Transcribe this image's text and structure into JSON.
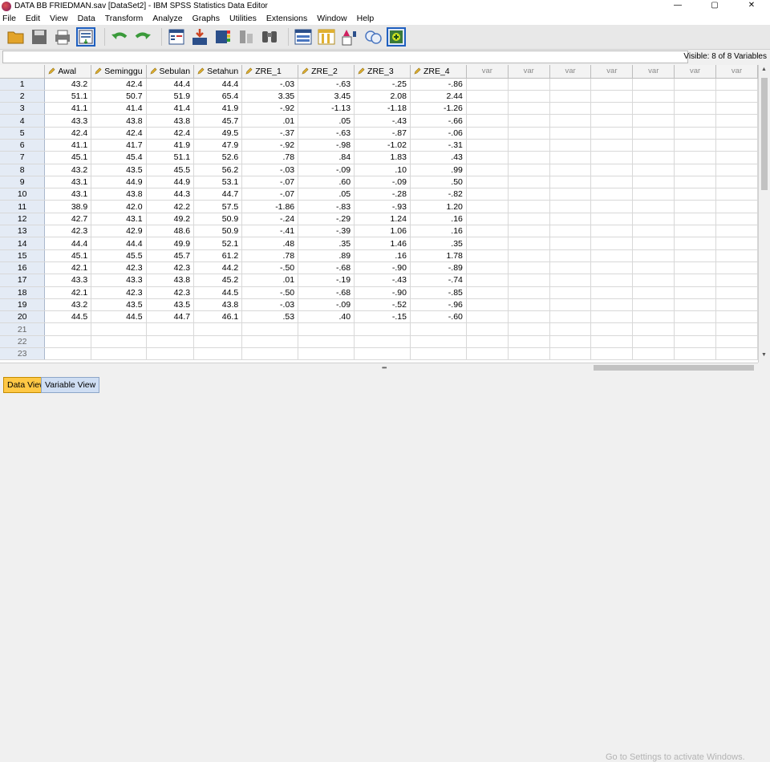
{
  "window": {
    "title": "DATA BB FRIEDMAN.sav [DataSet2] - IBM SPSS Statistics Data Editor",
    "minimize": "—",
    "maximize": "▢",
    "close": "✕"
  },
  "menu": [
    "File",
    "Edit",
    "View",
    "Data",
    "Transform",
    "Analyze",
    "Graphs",
    "Utilities",
    "Extensions",
    "Window",
    "Help"
  ],
  "toolbar": {
    "icons": [
      "open-folder-icon",
      "save-icon",
      "print-icon",
      "recall-dialog-icon",
      "undo-icon",
      "redo-icon",
      "goto-case-icon",
      "goto-variable-icon",
      "variables-icon",
      "run-descriptives-icon",
      "find-icon",
      "insert-cases-icon",
      "insert-variable-icon",
      "split-file-icon",
      "select-cases-icon",
      "value-labels-icon",
      "use-sets-icon"
    ]
  },
  "status": {
    "visible": "Visible: 8 of 8 Variables"
  },
  "grid": {
    "columns": [
      "Awal",
      "Seminggu",
      "Sebulan",
      "Setahun",
      "ZRE_1",
      "ZRE_2",
      "ZRE_3",
      "ZRE_4"
    ],
    "empty_columns": [
      "var",
      "var",
      "var",
      "var",
      "var",
      "var",
      "var"
    ],
    "rows": [
      [
        "1",
        "43.2",
        "42.4",
        "44.4",
        "44.4",
        "-.03",
        "-.63",
        "-.25",
        "-.86"
      ],
      [
        "2",
        "51.1",
        "50.7",
        "51.9",
        "65.4",
        "3.35",
        "3.45",
        "2.08",
        "2.44"
      ],
      [
        "3",
        "41.1",
        "41.4",
        "41.4",
        "41.9",
        "-.92",
        "-1.13",
        "-1.18",
        "-1.26"
      ],
      [
        "4",
        "43.3",
        "43.8",
        "43.8",
        "45.7",
        ".01",
        ".05",
        "-.43",
        "-.66"
      ],
      [
        "5",
        "42.4",
        "42.4",
        "42.4",
        "49.5",
        "-.37",
        "-.63",
        "-.87",
        "-.06"
      ],
      [
        "6",
        "41.1",
        "41.7",
        "41.9",
        "47.9",
        "-.92",
        "-.98",
        "-1.02",
        "-.31"
      ],
      [
        "7",
        "45.1",
        "45.4",
        "51.1",
        "52.6",
        ".78",
        ".84",
        "1.83",
        ".43"
      ],
      [
        "8",
        "43.2",
        "43.5",
        "45.5",
        "56.2",
        "-.03",
        "-.09",
        ".10",
        ".99"
      ],
      [
        "9",
        "43.1",
        "44.9",
        "44.9",
        "53.1",
        "-.07",
        ".60",
        "-.09",
        ".50"
      ],
      [
        "10",
        "43.1",
        "43.8",
        "44.3",
        "44.7",
        "-.07",
        ".05",
        "-.28",
        "-.82"
      ],
      [
        "11",
        "38.9",
        "42.0",
        "42.2",
        "57.5",
        "-1.86",
        "-.83",
        "-.93",
        "1.20"
      ],
      [
        "12",
        "42.7",
        "43.1",
        "49.2",
        "50.9",
        "-.24",
        "-.29",
        "1.24",
        ".16"
      ],
      [
        "13",
        "42.3",
        "42.9",
        "48.6",
        "50.9",
        "-.41",
        "-.39",
        "1.06",
        ".16"
      ],
      [
        "14",
        "44.4",
        "44.4",
        "49.9",
        "52.1",
        ".48",
        ".35",
        "1.46",
        ".35"
      ],
      [
        "15",
        "45.1",
        "45.5",
        "45.7",
        "61.2",
        ".78",
        ".89",
        ".16",
        "1.78"
      ],
      [
        "16",
        "42.1",
        "42.3",
        "42.3",
        "44.2",
        "-.50",
        "-.68",
        "-.90",
        "-.89"
      ],
      [
        "17",
        "43.3",
        "43.3",
        "43.8",
        "45.2",
        ".01",
        "-.19",
        "-.43",
        "-.74"
      ],
      [
        "18",
        "42.1",
        "42.3",
        "42.3",
        "44.5",
        "-.50",
        "-.68",
        "-.90",
        "-.85"
      ],
      [
        "19",
        "43.2",
        "43.5",
        "43.5",
        "43.8",
        "-.03",
        "-.09",
        "-.52",
        "-.96"
      ],
      [
        "20",
        "44.5",
        "44.5",
        "44.7",
        "46.1",
        ".53",
        ".40",
        "-.15",
        "-.60"
      ]
    ],
    "empty_rows": [
      "21",
      "22",
      "23"
    ]
  },
  "tabs": {
    "data_view": "Data View",
    "variable_view": "Variable View"
  },
  "watermark": "Go to Settings to activate Windows.",
  "colors": {
    "active_tab": "#ffc845",
    "inactive_tab": "#cfdef3",
    "row_header": "#e4ebf5"
  }
}
